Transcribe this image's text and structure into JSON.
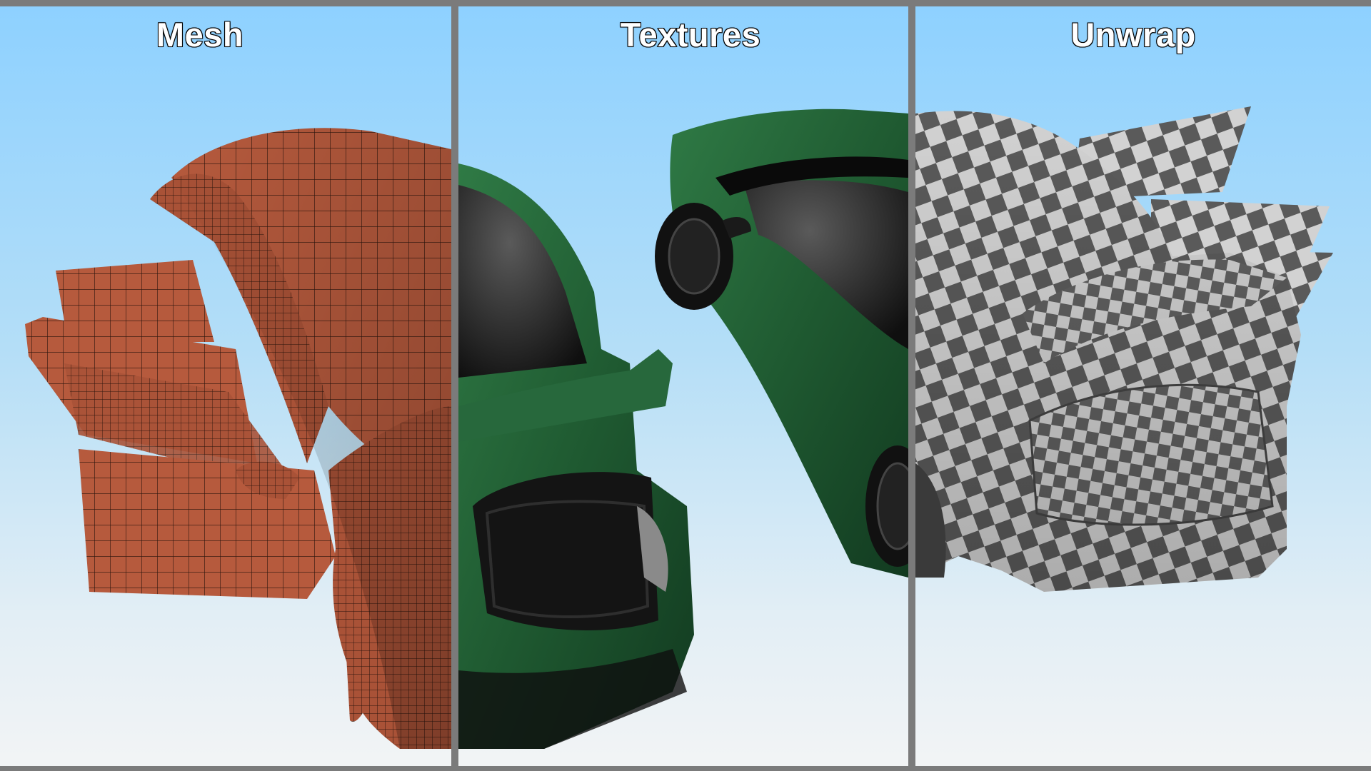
{
  "panels": [
    {
      "id": "mesh",
      "title": "Mesh",
      "material_color": "#b65a3d",
      "wire_color": "#2a140c"
    },
    {
      "id": "textures",
      "title": "Textures",
      "paint_color": "#1f5a31",
      "interior_color": "#1b1b1b"
    },
    {
      "id": "unwrap",
      "title": "Unwrap",
      "checker_light": "#d2d2d2",
      "checker_dark": "#5a5a5a"
    }
  ],
  "colors": {
    "divider": "#7b7b7b",
    "sky_top": "#8ed1ff",
    "sky_bottom": "#f2f4f5"
  }
}
